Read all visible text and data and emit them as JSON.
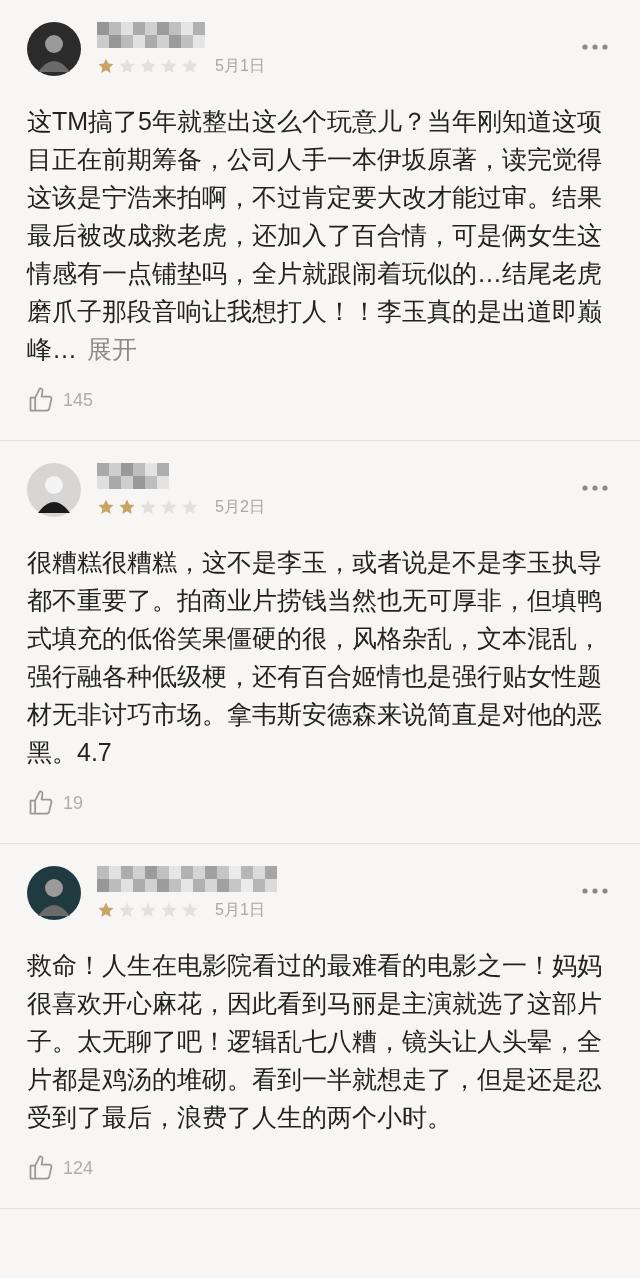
{
  "reviews": [
    {
      "stars": 1,
      "date": "5月1日",
      "text": "这TM搞了5年就整出这么个玩意儿？当年刚知道这项目正在前期筹备，公司人手一本伊坂原著，读完觉得这该是宁浩来拍啊，不过肯定要大改才能过审。结果最后被改成救老虎，还加入了百合情，可是俩女生这情感有一点铺垫吗，全片就跟闹着玩似的…结尾老虎磨爪子那段音响让我想打人！！李玉真的是出道即巅峰…",
      "more": "展开",
      "likes": "145"
    },
    {
      "stars": 2,
      "date": "5月2日",
      "text": "很糟糕很糟糕，这不是李玉，或者说是不是李玉执导都不重要了。拍商业片捞钱当然也无可厚非，但填鸭式填充的低俗笑果僵硬的很，风格杂乱，文本混乱，强行融各种低级梗，还有百合姬情也是强行贴女性题材无非讨巧市场。拿韦斯安德森来说简直是对他的恶黑。4.7",
      "likes": "19"
    },
    {
      "stars": 1,
      "date": "5月1日",
      "text": "救命！人生在电影院看过的最难看的电影之一！妈妈很喜欢开心麻花，因此看到马丽是主演就选了这部片子。太无聊了吧！逻辑乱七八糟，镜头让人头晕，全片都是鸡汤的堆砌。看到一半就想走了，但是还是忍受到了最后，浪费了人生的两个小时。",
      "likes": "124"
    }
  ]
}
